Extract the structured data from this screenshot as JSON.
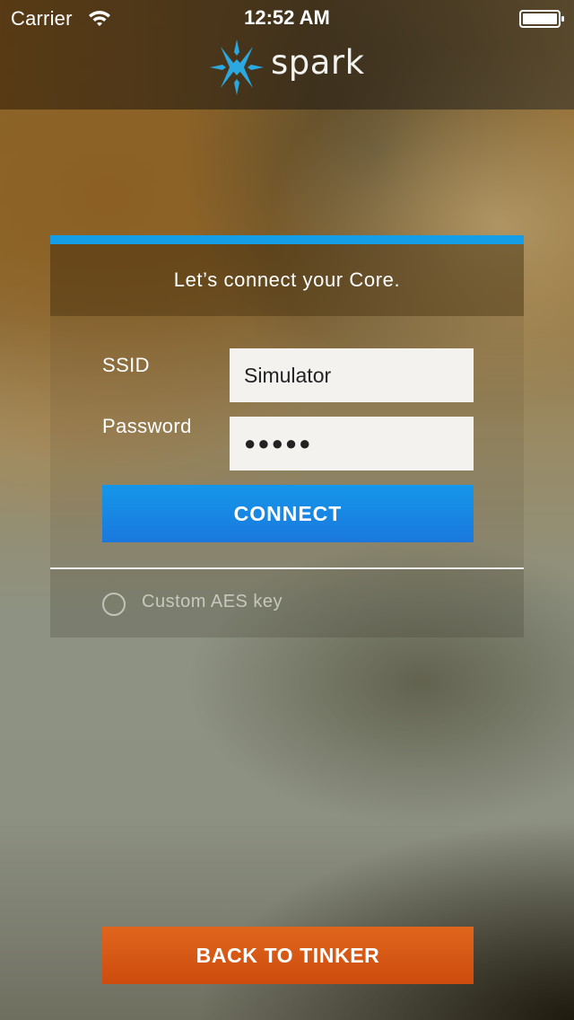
{
  "status_bar": {
    "carrier": "Carrier",
    "time": "12:52 AM",
    "wifi_icon": "wifi-icon",
    "battery_icon": "battery-icon"
  },
  "header": {
    "logo_icon": "spark-star-icon",
    "brand_name": "spark"
  },
  "card": {
    "title": "Let’s connect your Core.",
    "ssid_label": "SSID",
    "ssid_value": "Simulator",
    "password_label": "Password",
    "password_value": "●●●●●",
    "connect_label": "CONNECT",
    "custom_aes_label": "Custom AES key",
    "custom_aes_checked": false
  },
  "footer": {
    "back_label": "BACK TO TINKER"
  },
  "colors": {
    "accent_blue": "#159de6",
    "connect_blue": "#1787e4",
    "back_orange": "#d75a15",
    "logo_blue": "#2ba8e0"
  }
}
